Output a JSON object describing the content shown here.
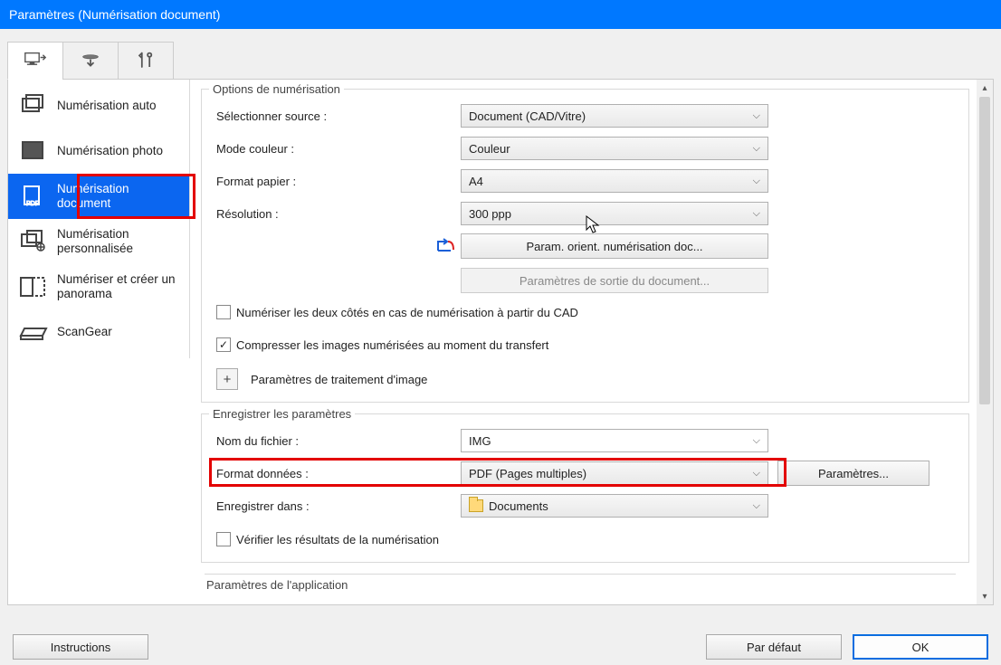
{
  "window": {
    "title": "Paramètres (Numérisation document)"
  },
  "tabs": [
    "scanner-to-pc",
    "pc-to-scanner",
    "tools"
  ],
  "sidebar": {
    "items": [
      {
        "label": "Numérisation auto"
      },
      {
        "label": "Numérisation photo"
      },
      {
        "label": "Numérisation document"
      },
      {
        "label": "Numérisation personnalisée"
      },
      {
        "label": "Numériser et créer un panorama"
      },
      {
        "label": "ScanGear"
      }
    ],
    "selected_index": 2
  },
  "scan_options": {
    "section_title": "Options de numérisation",
    "source_label": "Sélectionner source :",
    "source_value": "Document (CAD/Vitre)",
    "color_label": "Mode couleur :",
    "color_value": "Couleur",
    "paper_label": "Format papier :",
    "paper_value": "A4",
    "resolution_label": "Résolution :",
    "resolution_value": "300 ppp",
    "orientation_button": "Param. orient. numérisation doc...",
    "output_button": "Paramètres de sortie du document...",
    "chk_duplex": "Numériser les deux côtés en cas de numérisation à partir du CAD",
    "chk_duplex_checked": false,
    "chk_compress": "Compresser les images numérisées au moment du transfert",
    "chk_compress_checked": true,
    "image_processing_label": "Paramètres de traitement d'image"
  },
  "save_settings": {
    "section_title": "Enregistrer les paramètres",
    "filename_label": "Nom du fichier :",
    "filename_value": "IMG",
    "format_label": "Format données :",
    "format_value": "PDF (Pages multiples)",
    "format_params_button": "Paramètres...",
    "savein_label": "Enregistrer dans :",
    "savein_value": "Documents",
    "chk_verify": "Vérifier les résultats de la numérisation",
    "chk_verify_checked": false
  },
  "app_settings": {
    "section_title": "Paramètres de l'application"
  },
  "footer": {
    "instructions": "Instructions",
    "default": "Par défaut",
    "ok": "OK"
  }
}
